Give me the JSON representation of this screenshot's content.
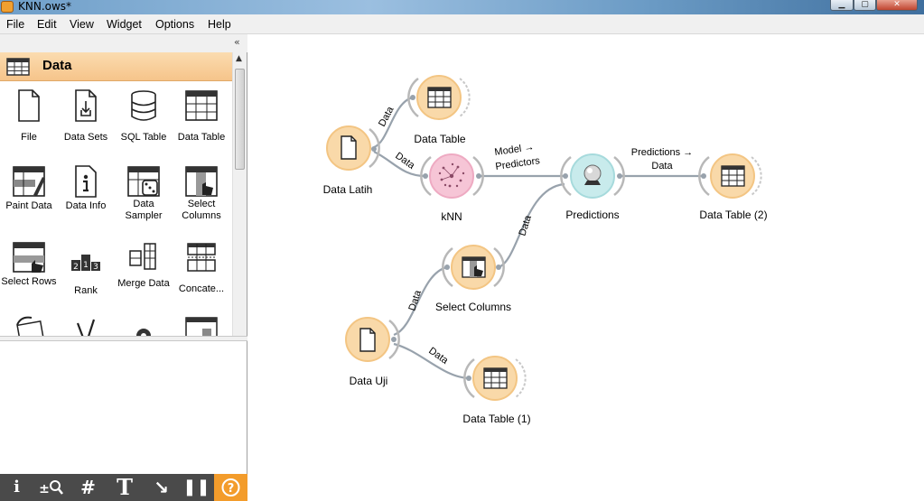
{
  "window": {
    "title": "KNN.ows*"
  },
  "menu": [
    "File",
    "Edit",
    "View",
    "Widget",
    "Options",
    "Help"
  ],
  "category": {
    "label": "Data",
    "collapse_glyph": "«"
  },
  "widgets": [
    {
      "label": "File",
      "icon": "file-icon"
    },
    {
      "label": "Data Sets",
      "icon": "data-sets-icon"
    },
    {
      "label": "SQL Table",
      "icon": "sql-table-icon"
    },
    {
      "label": "Data Table",
      "icon": "data-table-icon"
    },
    {
      "label": "Paint Data",
      "icon": "paint-data-icon"
    },
    {
      "label": "Data Info",
      "icon": "data-info-icon"
    },
    {
      "label": "Data Sampler",
      "icon": "data-sampler-icon"
    },
    {
      "label": "Select Columns",
      "icon": "select-columns-icon"
    },
    {
      "label": "Select Rows",
      "icon": "select-rows-icon"
    },
    {
      "label": "Rank",
      "icon": "rank-icon"
    },
    {
      "label": "Merge Data",
      "icon": "merge-data-icon"
    },
    {
      "label": "Concate...",
      "icon": "concatenate-icon"
    }
  ],
  "toolbar": {
    "info": "i",
    "zoom": "±",
    "grid": "#",
    "text": "T",
    "arrow": "↘",
    "pause": "❚❚",
    "help": "?"
  },
  "nodes": {
    "data_latih": "Data Latih",
    "data_table": "Data Table",
    "knn": "kNN",
    "predictions": "Predictions",
    "data_table_2": "Data Table (2)",
    "select_columns": "Select Columns",
    "data_uji": "Data Uji",
    "data_table_1": "Data Table (1)"
  },
  "links": {
    "latih_to_table": "Data",
    "latih_to_knn": "Data",
    "knn_to_pred_1": "Model →",
    "knn_to_pred_2": "Predictors",
    "pred_to_table_1": "Predictions →",
    "pred_to_table_2": "Data",
    "select_to_pred": "Data",
    "uji_to_select": "Data",
    "uji_to_table1": "Data"
  },
  "colors": {
    "data_node": "#f9d9a9",
    "model_node": "#f6c5d6",
    "eval_node": "#c8ebec",
    "link": "#98a2ac",
    "help": "#f39c2b"
  }
}
